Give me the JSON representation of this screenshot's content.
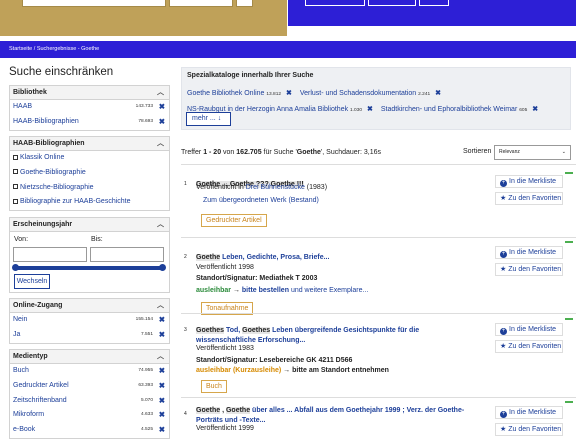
{
  "breadcrumb": {
    "home": "Startseite",
    "sep": "/",
    "current": "Suchergebnisse - Goethe"
  },
  "sidebar": {
    "title": "Suche einschränken",
    "bibliothek": {
      "header": "Bibliothek",
      "items": [
        {
          "label": "HAAB",
          "count": "143.733"
        },
        {
          "label": "HAAB-Bibliographien",
          "count": "78.693"
        }
      ]
    },
    "haab_bib": {
      "header": "HAAB-Bibliographien",
      "items": [
        {
          "label": "Klassik Online"
        },
        {
          "label": "Goethe-Bibliographie"
        },
        {
          "label": "Nietzsche-Bibliographie"
        },
        {
          "label": "Bibliographie zur HAAB-Geschichte"
        }
      ]
    },
    "jahr": {
      "header": "Erscheinungsjahr",
      "von": "Von:",
      "bis": "Bis:",
      "button": "Wechseln"
    },
    "online": {
      "header": "Online-Zugang",
      "items": [
        {
          "label": "Nein",
          "count": "155.154"
        },
        {
          "label": "Ja",
          "count": "7.551"
        }
      ]
    },
    "medientyp": {
      "header": "Medientyp",
      "items": [
        {
          "label": "Buch",
          "count": "74.955"
        },
        {
          "label": "Gedruckter Artikel",
          "count": "63.393"
        },
        {
          "label": "Zeitschriftenband",
          "count": "5.070"
        },
        {
          "label": "Mikroform",
          "count": "4.633"
        },
        {
          "label": "e-Book",
          "count": "4.525"
        }
      ]
    }
  },
  "special": {
    "title": "Spezialkataloge innerhalb Ihrer Suche",
    "row1": [
      {
        "label": "Goethe Bibliothek Online",
        "count": "13.812"
      },
      {
        "label": "Verlust- und Schadensdokumentation",
        "count": "2.241"
      }
    ],
    "row2": [
      {
        "label": "NS-Raubgut in der Herzogin Anna Amalia Bibliothek",
        "count": "1.030"
      },
      {
        "label": "Stadtkirchen- und Ephoralbibliothek Weimar",
        "count": "605"
      }
    ],
    "more": "mehr ..."
  },
  "summary": {
    "prefix": "Treffer ",
    "range": "1 - 20",
    "mid": " von ",
    "total": "162.705",
    "text": " für Suche '",
    "query": "Goethe",
    "suffix": "', Suchdauer: 3,16s"
  },
  "sort": {
    "label": "Sortieren",
    "value": "Relevanz"
  },
  "actions": {
    "merk": "In die Merkliste",
    "fav": "Zu den Favoriten"
  },
  "results": [
    {
      "num": "1",
      "title": "Goethe ... Goethe ??? Goethe !!!",
      "pub_prefix": "Veröffentlicht in ",
      "pub_link": "Drei Bühnenstücke",
      "pub_suffix": " (1983)",
      "link": "Zum übergeordneten Werk (Bestand)",
      "tag": "Gedruckter Artikel"
    },
    {
      "num": "2",
      "title_a": "Goethe",
      "title_b": " Leben, Gedichte, Prosa, Briefe...",
      "pub": "Veröffentlicht 1998",
      "sig": "Standort/Signatur: Mediathek T 2003",
      "avail": "ausleihbar",
      "arrow": " → ",
      "order": "bitte bestellen",
      "more": "und weitere Exemplare...",
      "tag": "Tonaufnahme"
    },
    {
      "num": "3",
      "title_a": "Goethes",
      "title_b": " Tod, ",
      "title_c": "Goethes",
      "title_d": " Leben übergreifende Gesichtspunkte für die wissenschaftliche Erforschung...",
      "pub": "Veröffentlicht 1983",
      "sig": "Standort/Signatur: Lesebereiche GK 4211 D566",
      "avail": "ausleihbar (Kurzausleihe)",
      "arrow": " → ",
      "order": "bitte am Standort entnehmen",
      "tag": "Buch"
    },
    {
      "num": "4",
      "title_a": "Goethe",
      "title_b": " , ",
      "title_c": "Goethe",
      "title_d": " über alles ... Abfall aus dem Goethejahr 1999 ; Verz. der Goethe-Porträts und -Texte...",
      "pub": "Veröffentlicht 1999"
    }
  ]
}
